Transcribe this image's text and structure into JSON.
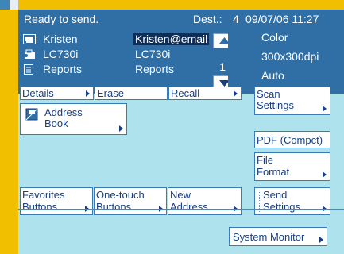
{
  "status": {
    "message": "Ready to send.",
    "dest_label": "Dest.:",
    "dest_count": "4",
    "datetime": "09/07/06 11:27"
  },
  "address_list": {
    "rows": [
      {
        "icon": "email-icon",
        "name": "Kristen",
        "address": "Kristen@email",
        "selected": true
      },
      {
        "icon": "fax-icon",
        "name": "LC730i",
        "address": "LC730i",
        "selected": false
      },
      {
        "icon": "folder-icon",
        "name": "Reports",
        "address": "Reports",
        "selected": false
      }
    ],
    "page_count": "1"
  },
  "scan_specs": {
    "color": "Color",
    "resolution": "300x300dpi",
    "size": "Auto"
  },
  "buttons": {
    "details": "Details",
    "erase": "Erase",
    "recall": "Recall",
    "scan_settings": [
      "Scan",
      "Settings"
    ],
    "address_book": [
      "Address",
      "Book"
    ],
    "pdf": "PDF (Compct)",
    "file_format": [
      "File",
      "Format"
    ],
    "favorites": [
      "Favorites",
      "Buttons"
    ],
    "one_touch": [
      "One-touch",
      "Buttons"
    ],
    "new_address": [
      "New",
      "Address"
    ],
    "send_settings": [
      "Send",
      "Settings"
    ],
    "system_monitor": "System Monitor"
  },
  "colors": {
    "panel_blue": "#2f6fa6",
    "screen_bg": "#aee2ec",
    "button_text": "#173f83",
    "frame": "#f2be00"
  }
}
